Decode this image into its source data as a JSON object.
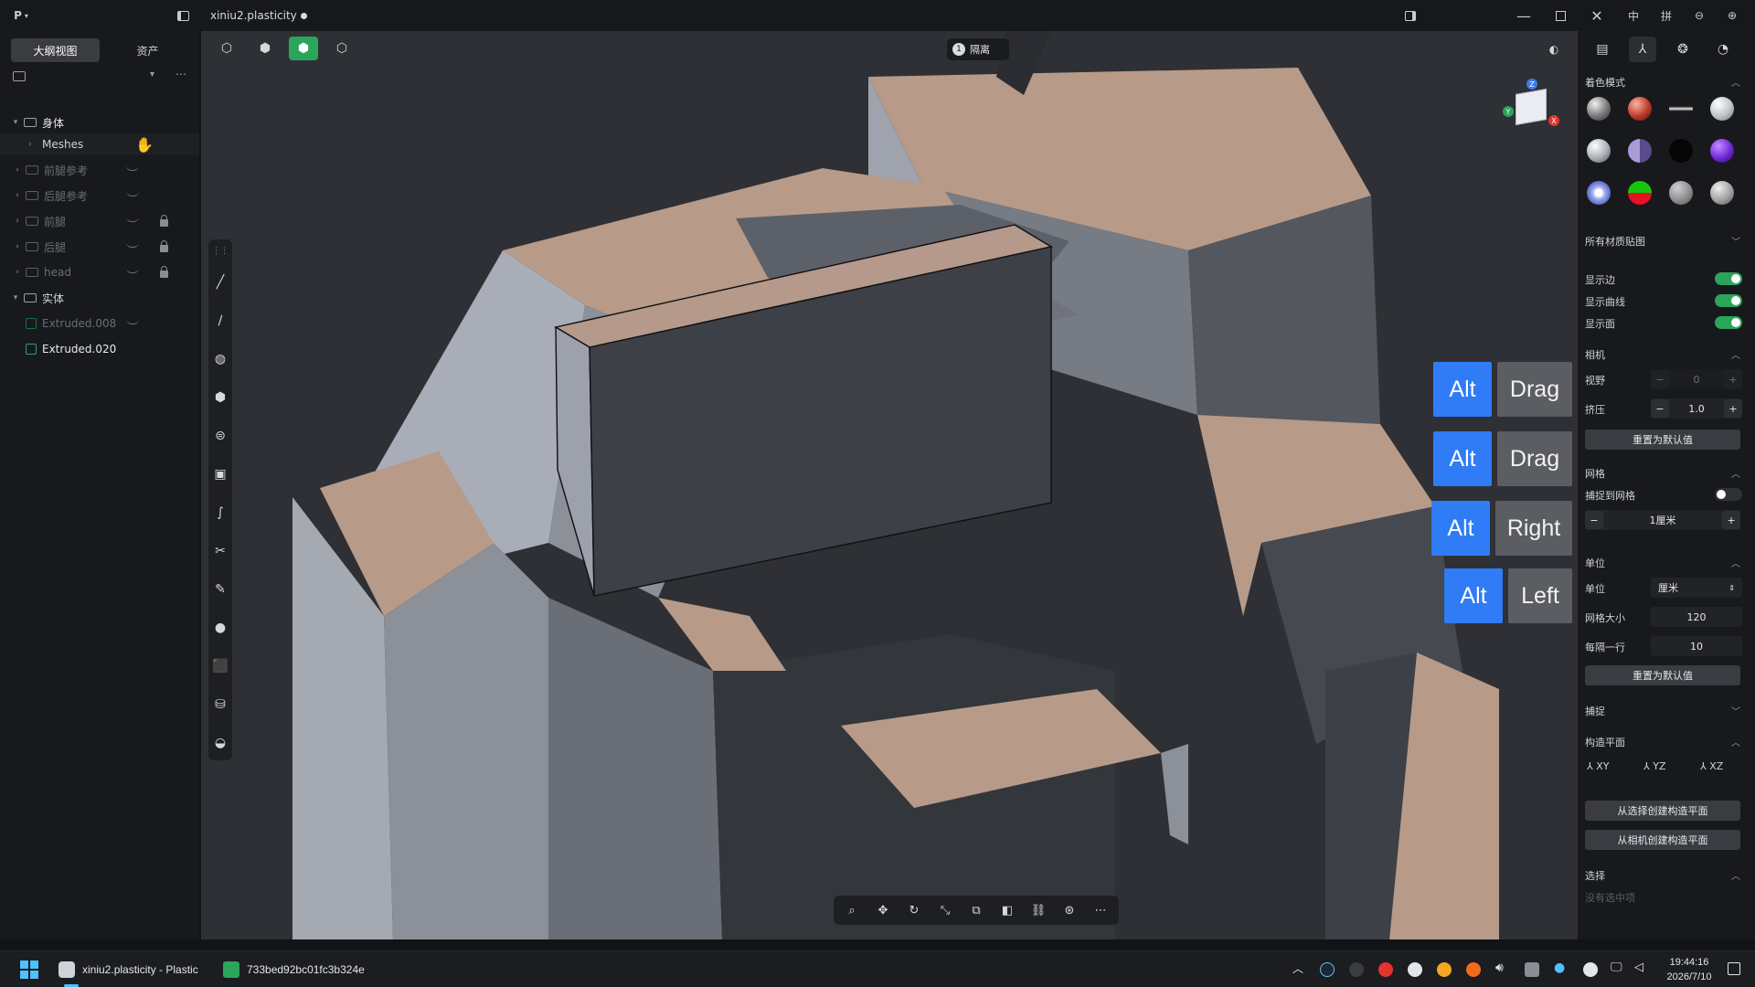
{
  "app": {
    "menu_glyph": "P",
    "doc_title": "xiniu2.plasticity",
    "ime_mode": "中",
    "ime_width": "拼"
  },
  "outline": {
    "tabs": [
      "大纲视图",
      "资产"
    ],
    "items": [
      {
        "label": "身体",
        "state": "expanded"
      },
      {
        "label": "Meshes",
        "state": "child"
      },
      {
        "label": "前腿参考",
        "state": "hidden"
      },
      {
        "label": "后腿参考",
        "state": "hidden"
      },
      {
        "label": "前腿",
        "state": "hidden-locked"
      },
      {
        "label": "后腿",
        "state": "hidden-locked"
      },
      {
        "label": "head",
        "state": "hidden-locked"
      },
      {
        "label": "实体",
        "state": "expanded"
      },
      {
        "label": "Extruded.008",
        "state": "hidden"
      },
      {
        "label": "Extruded.020",
        "state": "visible"
      }
    ]
  },
  "viewport": {
    "isolate_count": "1",
    "isolate_label": "隔离",
    "gizmo_axes": {
      "z": "Z",
      "y": "Y",
      "x": "X"
    }
  },
  "key_overlays": [
    {
      "modifier": "Alt",
      "action": "Drag"
    },
    {
      "modifier": "Alt",
      "action": "Drag"
    },
    {
      "modifier": "Alt",
      "action": "Right"
    },
    {
      "modifier": "Alt",
      "action": "Left"
    }
  ],
  "right_panel": {
    "shading": {
      "title": "着色模式"
    },
    "material_dropdown": "所有材质贴图",
    "toggles": [
      {
        "label": "显示边",
        "on": true
      },
      {
        "label": "显示曲线",
        "on": true
      },
      {
        "label": "显示面",
        "on": true
      }
    ],
    "camera": {
      "title": "相机",
      "fov_label": "视野",
      "fov_value": "0",
      "squash_label": "挤压",
      "squash_value": "1.0",
      "reset": "重置为默认值"
    },
    "grid": {
      "title": "网格",
      "snap_label": "捕捉到网格",
      "snap_on": false,
      "step_value": "1厘米"
    },
    "units": {
      "title": "单位",
      "unit_label": "单位",
      "unit_value": "厘米",
      "size_label": "网格大小",
      "size_value": "120",
      "every_label": "每隔一行",
      "every_value": "10",
      "reset": "重置为默认值"
    },
    "snap": {
      "title": "捕捉"
    },
    "cplane": {
      "title": "构造平面",
      "xy": "XY",
      "yz": "YZ",
      "xz": "XZ",
      "from_selection": "从选择创建构造平面",
      "from_camera": "从相机创建构造平面"
    },
    "selection": {
      "title": "选择",
      "empty": "没有选中项"
    }
  },
  "taskbar": {
    "app1": "xiniu2.plasticity - Plastic",
    "app2": "733bed92bc01fc3b324e",
    "time": "19:44:16",
    "date": "2026/7/10"
  },
  "colors": {
    "accent_green": "#2aa55b",
    "key_blue": "#2f7cf6",
    "face_tan": "#b89a88"
  }
}
